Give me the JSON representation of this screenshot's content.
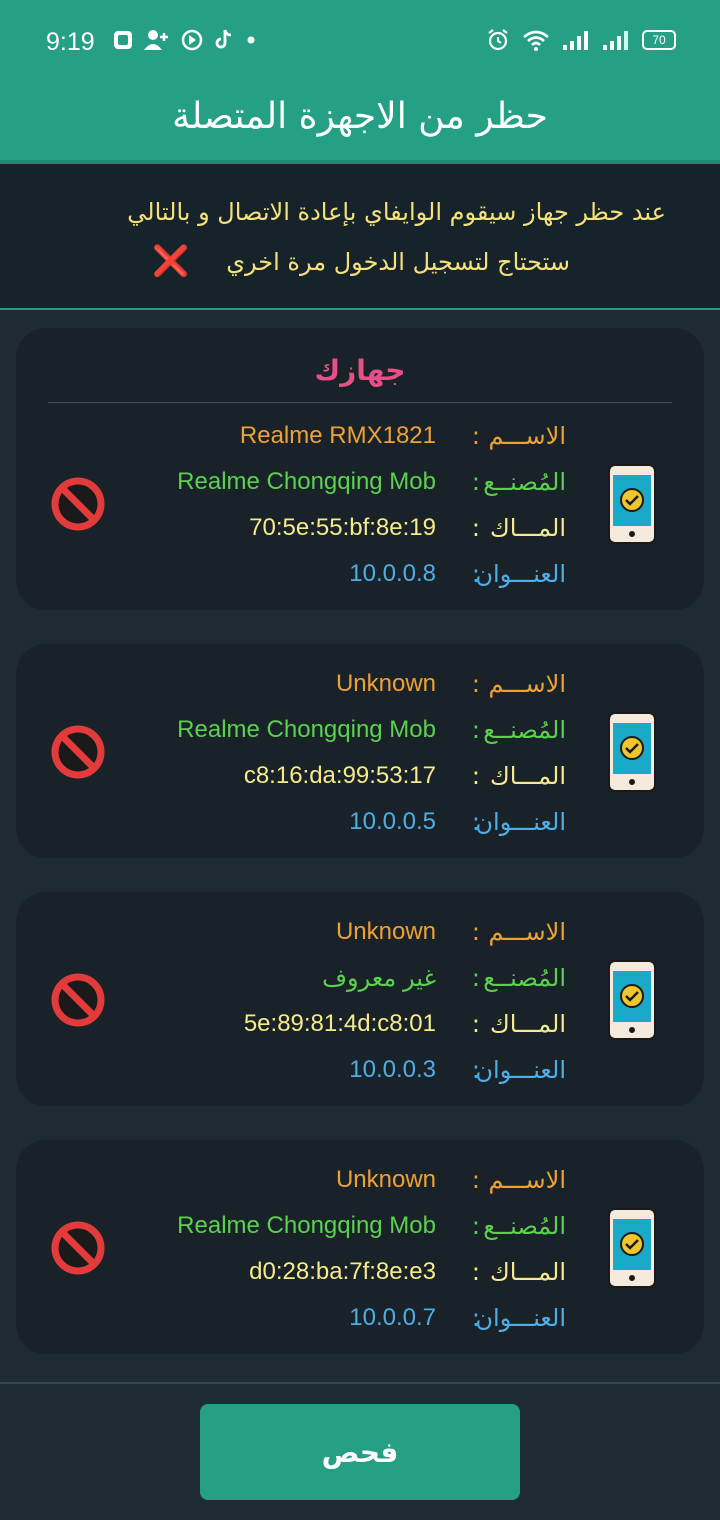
{
  "status_bar": {
    "time": "9:19",
    "battery": "70"
  },
  "header": {
    "title": "حظر من الاجهزة المتصلة"
  },
  "notice": {
    "line1": "عند حظر جهاز سيقوم الوايفاي بإعادة الاتصال و بالتالي",
    "line2": "ستحتاج لتسجيل الدخول مرة اخري",
    "icon": "❌"
  },
  "labels": {
    "name": "الاســـم",
    "maker": "المُصنــع",
    "mac": "المـــاك",
    "address": "العنـــوان",
    "separator": ":"
  },
  "devices": [
    {
      "header": "جهازك",
      "name": "Realme RMX1821",
      "maker": "Realme Chongqing Mob",
      "mac": "70:5e:55:bf:8e:19",
      "address": "10.0.0.8"
    },
    {
      "name": "Unknown",
      "maker": "Realme Chongqing Mob",
      "mac": "c8:16:da:99:53:17",
      "address": "10.0.0.5"
    },
    {
      "name": "Unknown",
      "maker": "غير معروف",
      "mac": "5e:89:81:4d:c8:01",
      "address": "10.0.0.3"
    },
    {
      "name": "Unknown",
      "maker": "Realme Chongqing Mob",
      "mac": "d0:28:ba:7f:8e:e3",
      "address": "10.0.0.7"
    }
  ],
  "scan_button": {
    "label": "فحص"
  },
  "colors": {
    "accent": "#26a085",
    "name": "#f0a136",
    "maker": "#5bd14e",
    "mac": "#f6ea8a",
    "address": "#4eaee6",
    "your_device": "#e84f8a"
  }
}
